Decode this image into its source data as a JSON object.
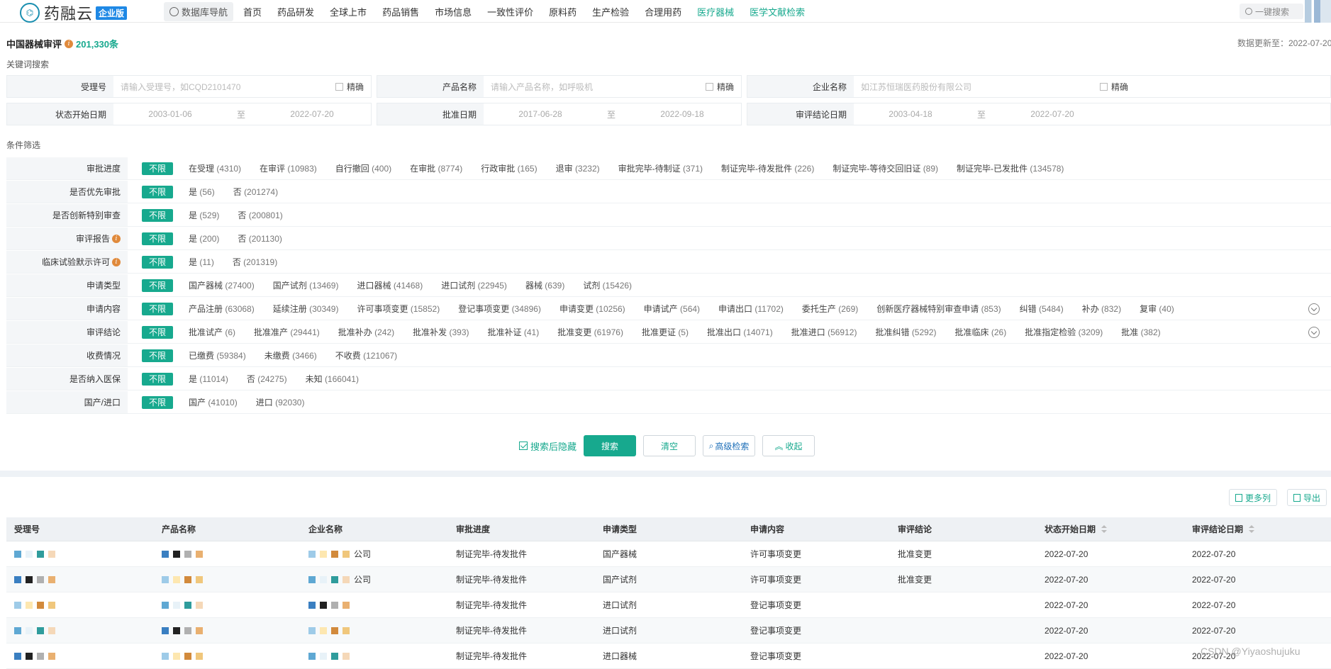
{
  "header": {
    "logo_mark": "⌬",
    "logo_text": "药融云",
    "logo_badge": "企业版",
    "nav": [
      "数据库导航",
      "首页",
      "药品研发",
      "全球上市",
      "药品销售",
      "市场信息",
      "一致性评价",
      "原料药",
      "生产检验",
      "合理用药",
      "医疗器械",
      "医学文献检索"
    ],
    "search_placeholder": "一键搜索"
  },
  "page": {
    "title": "中国器械审评",
    "count": "201,330条",
    "update": "数据更新至：2022-07-20"
  },
  "keyword": {
    "section": "关键词搜索",
    "exact": "精确",
    "to": "至",
    "fields": [
      {
        "label": "受理号",
        "placeholder": "请输入受理号，如CQD2101470"
      },
      {
        "label": "产品名称",
        "placeholder": "请输入产品名称，如呼吸机"
      },
      {
        "label": "企业名称",
        "placeholder": "如江苏恒瑞医药股份有限公司"
      }
    ],
    "dates": [
      {
        "label": "状态开始日期",
        "from": "2003-01-06",
        "to": "2022-07-20"
      },
      {
        "label": "批准日期",
        "from": "2017-06-28",
        "to": "2022-09-18"
      },
      {
        "label": "审评结论日期",
        "from": "2003-04-18",
        "to": "2022-07-20"
      }
    ]
  },
  "filters": {
    "section": "条件筛选",
    "unlimited": "不限",
    "rows": [
      {
        "label": "审批进度",
        "opts": [
          [
            "在受理",
            "(4310)"
          ],
          [
            "在审评",
            "(10983)"
          ],
          [
            "自行撤回",
            "(400)"
          ],
          [
            "在审批",
            "(8774)"
          ],
          [
            "行政审批",
            "(165)"
          ],
          [
            "退审",
            "(3232)"
          ],
          [
            "审批完毕-待制证",
            "(371)"
          ],
          [
            "制证完毕-待发批件",
            "(226)"
          ],
          [
            "制证完毕-等待交回旧证",
            "(89)"
          ],
          [
            "制证完毕-已发批件",
            "(134578)"
          ]
        ]
      },
      {
        "label": "是否优先审批",
        "opts": [
          [
            "是",
            "(56)"
          ],
          [
            "否",
            "(201274)"
          ]
        ]
      },
      {
        "label": "是否创新特别审查",
        "opts": [
          [
            "是",
            "(529)"
          ],
          [
            "否",
            "(200801)"
          ]
        ]
      },
      {
        "label": "审评报告",
        "info": true,
        "opts": [
          [
            "是",
            "(200)"
          ],
          [
            "否",
            "(201130)"
          ]
        ]
      },
      {
        "label": "临床试验默示许可",
        "info": true,
        "opts": [
          [
            "是",
            "(11)"
          ],
          [
            "否",
            "(201319)"
          ]
        ]
      },
      {
        "label": "申请类型",
        "opts": [
          [
            "国产器械",
            "(27400)"
          ],
          [
            "国产试剂",
            "(13469)"
          ],
          [
            "进口器械",
            "(41468)"
          ],
          [
            "进口试剂",
            "(22945)"
          ],
          [
            "器械",
            "(639)"
          ],
          [
            "试剂",
            "(15426)"
          ]
        ]
      },
      {
        "label": "申请内容",
        "expand": true,
        "opts": [
          [
            "产品注册",
            "(63068)"
          ],
          [
            "延续注册",
            "(30349)"
          ],
          [
            "许可事项变更",
            "(15852)"
          ],
          [
            "登记事项变更",
            "(34896)"
          ],
          [
            "申请变更",
            "(10256)"
          ],
          [
            "申请试产",
            "(564)"
          ],
          [
            "申请出口",
            "(11702)"
          ],
          [
            "委托生产",
            "(269)"
          ],
          [
            "创新医疗器械特别审查申请",
            "(853)"
          ],
          [
            "纠错",
            "(5484)"
          ],
          [
            "补办",
            "(832)"
          ],
          [
            "复审",
            "(40)"
          ]
        ]
      },
      {
        "label": "审评结论",
        "expand": true,
        "opts": [
          [
            "批准试产",
            "(6)"
          ],
          [
            "批准准产",
            "(29441)"
          ],
          [
            "批准补办",
            "(242)"
          ],
          [
            "批准补发",
            "(393)"
          ],
          [
            "批准补证",
            "(41)"
          ],
          [
            "批准变更",
            "(61976)"
          ],
          [
            "批准更证",
            "(5)"
          ],
          [
            "批准出口",
            "(14071)"
          ],
          [
            "批准进口",
            "(56912)"
          ],
          [
            "批准纠错",
            "(5292)"
          ],
          [
            "批准临床",
            "(26)"
          ],
          [
            "批准指定检验",
            "(3209)"
          ],
          [
            "批准",
            "(382)"
          ]
        ]
      },
      {
        "label": "收费情况",
        "opts": [
          [
            "已缴费",
            "(59384)"
          ],
          [
            "未缴费",
            "(3466)"
          ],
          [
            "不收费",
            "(121067)"
          ]
        ]
      },
      {
        "label": "是否纳入医保",
        "opts": [
          [
            "是",
            "(11014)"
          ],
          [
            "否",
            "(24275)"
          ],
          [
            "未知",
            "(166041)"
          ]
        ]
      },
      {
        "label": "国产/进口",
        "opts": [
          [
            "国产",
            "(41010)"
          ],
          [
            "进口",
            "(92030)"
          ]
        ]
      }
    ]
  },
  "actions": {
    "hide_after_search": "搜索后隐藏",
    "search": "搜索",
    "clear": "清空",
    "advanced": "高级检索",
    "collapse": "收起",
    "more_cols": "更多列",
    "export": "导出"
  },
  "table": {
    "columns": [
      "受理号",
      "产品名称",
      "企业名称",
      "审批进度",
      "申请类型",
      "申请内容",
      "审评结论",
      "状态开始日期",
      "审评结论日期"
    ],
    "rows": [
      {
        "company": "公司",
        "progress": "制证完毕-待发批件",
        "type": "国产器械",
        "content": "许可事项变更",
        "conclusion": "批准变更",
        "start": "2022-07-20",
        "end": "2022-07-20"
      },
      {
        "company": "公司",
        "progress": "制证完毕-待发批件",
        "type": "国产试剂",
        "content": "许可事项变更",
        "conclusion": "批准变更",
        "start": "2022-07-20",
        "end": "2022-07-20"
      },
      {
        "company": "",
        "progress": "制证完毕-待发批件",
        "type": "进口试剂",
        "content": "登记事项变更",
        "conclusion": "",
        "start": "2022-07-20",
        "end": "2022-07-20"
      },
      {
        "company": "",
        "progress": "制证完毕-待发批件",
        "type": "进口试剂",
        "content": "登记事项变更",
        "conclusion": "",
        "start": "2022-07-20",
        "end": "2022-07-20"
      },
      {
        "company": "",
        "progress": "制证完毕-待发批件",
        "type": "进口器械",
        "content": "登记事项变更",
        "conclusion": "",
        "start": "2022-07-20",
        "end": "2022-07-20"
      }
    ]
  },
  "watermark": "CSDN @Yiyaoshujuku",
  "colors": {
    "accent": "#17a98e",
    "brand_blue": "#1e88e5"
  }
}
